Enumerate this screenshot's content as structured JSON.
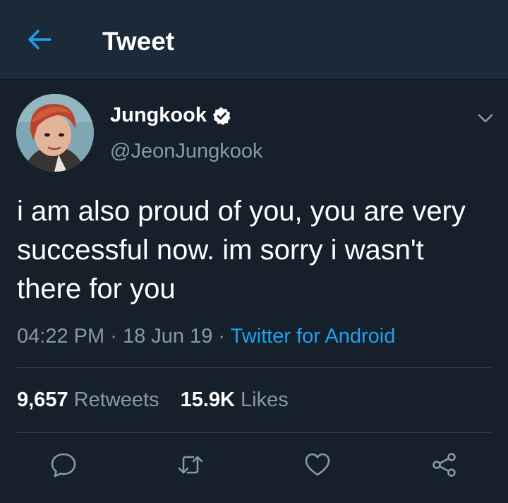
{
  "header": {
    "title": "Tweet",
    "back_icon": "arrow-left-icon"
  },
  "tweet": {
    "author": {
      "name": "Jungkook",
      "handle": "@JeonJungkook",
      "verified": true
    },
    "text": "i am also proud of you, you are very successful now. im sorry i wasn't there for you",
    "time": "04:22 PM",
    "date": "18 Jun 19",
    "separator": "·",
    "source": "Twitter for Android"
  },
  "stats": {
    "retweets_count": "9,657",
    "retweets_label": "Retweets",
    "likes_count": "15.9K",
    "likes_label": "Likes"
  },
  "actions": [
    "reply-icon",
    "retweet-icon",
    "like-icon",
    "share-icon"
  ],
  "colors": {
    "background": "#15202b",
    "header_bg": "#1c2938",
    "accent": "#1da1f2",
    "secondary_text": "#8899a6",
    "divider": "#38444d"
  }
}
